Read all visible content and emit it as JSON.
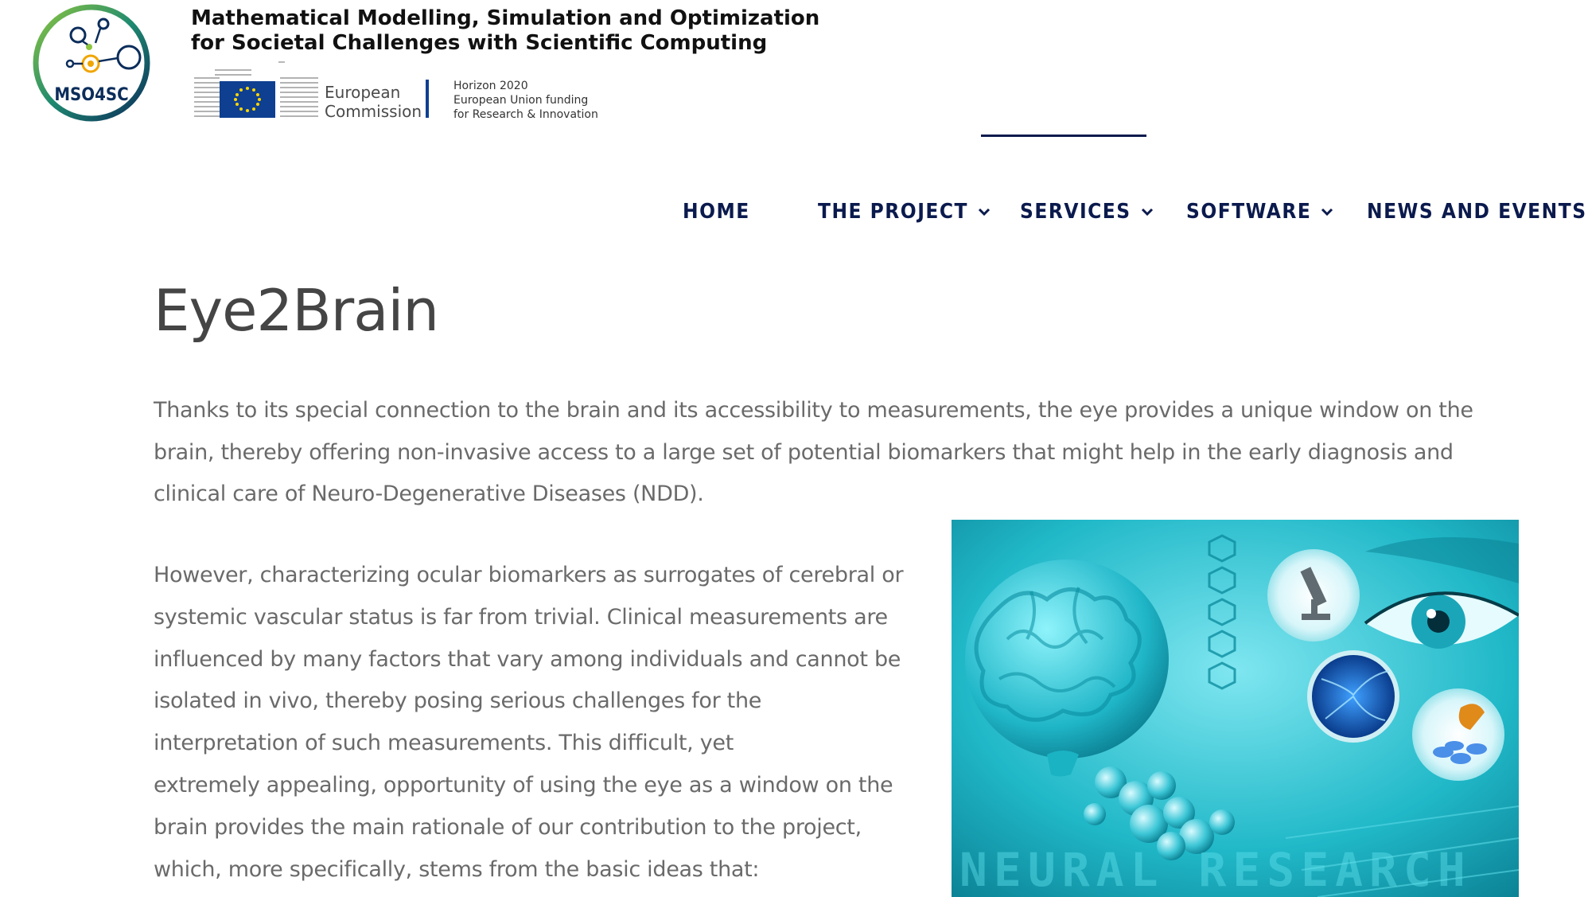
{
  "header": {
    "logo_text": "MSO4SC",
    "title_line1": "Mathematical Modelling, Simulation and Optimization",
    "title_line2": "for Societal Challenges with Scientific Computing",
    "ec_line1": "European",
    "ec_line2": "Commission",
    "h2020_line1": "Horizon 2020",
    "h2020_line2": "European Union funding",
    "h2020_line3": "for Research & Innovation"
  },
  "nav": {
    "items": [
      {
        "label": "HOME",
        "has_dropdown": false
      },
      {
        "label": "THE PROJECT",
        "has_dropdown": true
      },
      {
        "label": "SERVICES",
        "has_dropdown": true,
        "active": true
      },
      {
        "label": "SOFTWARE",
        "has_dropdown": true
      },
      {
        "label": "NEWS AND EVENTS",
        "has_dropdown": true
      }
    ]
  },
  "main": {
    "title": "Eye2Brain",
    "paragraph1": "Thanks to its special connection to the brain and its accessibility to measurements, the eye provides a unique window on the brain, thereby offering non-invasive access to a large set of potential biomarkers that might help in the early diagnosis and clinical care of Neuro-Degenerative Diseases (NDD).",
    "paragraph2_lines": [
      "However, characterizing ocular biomarkers as surrogates of cerebral or",
      "systemic vascular status is far from trivial. Clinical measurements are",
      "influenced by many factors that vary among individuals and cannot be",
      "isolated in vivo, thereby posing serious challenges for the",
      "interpretation of such measurements. This difficult, yet",
      "extremely appealing, opportunity of using the eye as a window on the",
      "brain provides the main rationale of our contribution to the project,",
      "which, more specifically, stems from the basic ideas that:"
    ],
    "image_caption_text": "NEURAL RESEARCH"
  },
  "colors": {
    "nav_text": "#0b1a4d",
    "body_text": "#6a6a6a",
    "title_text": "#454545",
    "eu_blue": "#0e3f91",
    "image_cyan": "#1ab3c4"
  }
}
